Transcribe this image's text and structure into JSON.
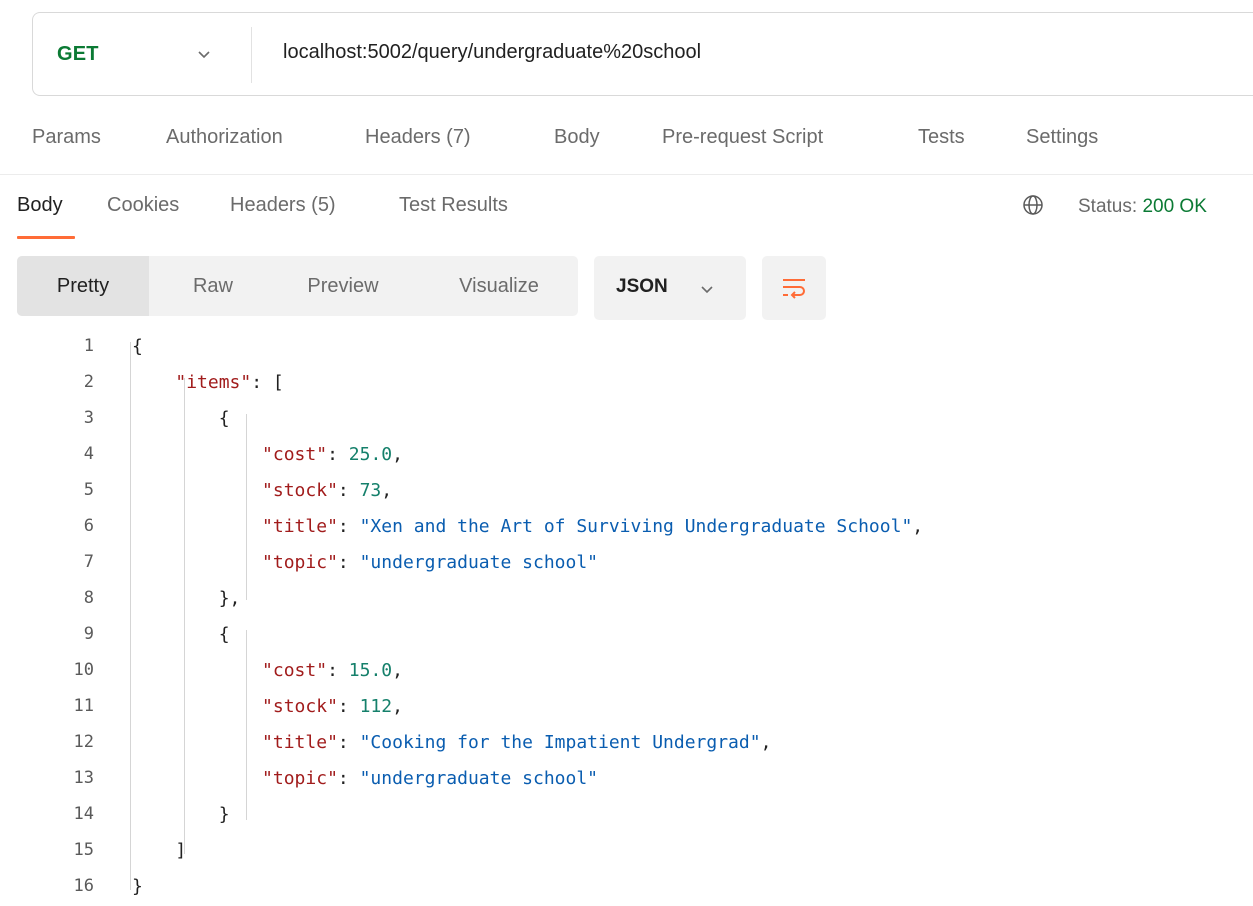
{
  "request": {
    "method": "GET",
    "url": "localhost:5002/query/undergraduate%20school"
  },
  "request_tabs": [
    {
      "label": "Params"
    },
    {
      "label": "Authorization"
    },
    {
      "label": "Headers (7)"
    },
    {
      "label": "Body"
    },
    {
      "label": "Pre-request Script"
    },
    {
      "label": "Tests"
    },
    {
      "label": "Settings"
    }
  ],
  "response_tabs": [
    {
      "label": "Body",
      "active": true
    },
    {
      "label": "Cookies"
    },
    {
      "label": "Headers (5)"
    },
    {
      "label": "Test Results"
    }
  ],
  "status": {
    "label": "Status:",
    "value": "200 OK"
  },
  "view_modes": [
    {
      "label": "Pretty",
      "active": true
    },
    {
      "label": "Raw"
    },
    {
      "label": "Preview"
    },
    {
      "label": "Visualize"
    }
  ],
  "format": "JSON",
  "icons": {
    "method_dropdown": "chevron-down-icon",
    "network": "globe-icon",
    "format_dropdown": "chevron-down-icon",
    "wrap": "wrap-lines-icon"
  },
  "colors": {
    "method": "#0b7a34",
    "status_ok": "#0b7a34",
    "accent": "#ff6c37",
    "json_key": "#a11c1c",
    "json_string": "#0a5db0",
    "json_number": "#15806b"
  },
  "code_lines": [
    [
      {
        "t": "{",
        "c": "punc"
      }
    ],
    [
      {
        "t": "    ",
        "c": "punc"
      },
      {
        "t": "\"items\"",
        "c": "key"
      },
      {
        "t": ": [",
        "c": "punc"
      }
    ],
    [
      {
        "t": "        {",
        "c": "punc"
      }
    ],
    [
      {
        "t": "            ",
        "c": "punc"
      },
      {
        "t": "\"cost\"",
        "c": "key"
      },
      {
        "t": ": ",
        "c": "punc"
      },
      {
        "t": "25.0",
        "c": "num"
      },
      {
        "t": ",",
        "c": "punc"
      }
    ],
    [
      {
        "t": "            ",
        "c": "punc"
      },
      {
        "t": "\"stock\"",
        "c": "key"
      },
      {
        "t": ": ",
        "c": "punc"
      },
      {
        "t": "73",
        "c": "num"
      },
      {
        "t": ",",
        "c": "punc"
      }
    ],
    [
      {
        "t": "            ",
        "c": "punc"
      },
      {
        "t": "\"title\"",
        "c": "key"
      },
      {
        "t": ": ",
        "c": "punc"
      },
      {
        "t": "\"Xen and the Art of Surviving Undergraduate School\"",
        "c": "str"
      },
      {
        "t": ",",
        "c": "punc"
      }
    ],
    [
      {
        "t": "            ",
        "c": "punc"
      },
      {
        "t": "\"topic\"",
        "c": "key"
      },
      {
        "t": ": ",
        "c": "punc"
      },
      {
        "t": "\"undergraduate school\"",
        "c": "str"
      }
    ],
    [
      {
        "t": "        },",
        "c": "punc"
      }
    ],
    [
      {
        "t": "        {",
        "c": "punc"
      }
    ],
    [
      {
        "t": "            ",
        "c": "punc"
      },
      {
        "t": "\"cost\"",
        "c": "key"
      },
      {
        "t": ": ",
        "c": "punc"
      },
      {
        "t": "15.0",
        "c": "num"
      },
      {
        "t": ",",
        "c": "punc"
      }
    ],
    [
      {
        "t": "            ",
        "c": "punc"
      },
      {
        "t": "\"stock\"",
        "c": "key"
      },
      {
        "t": ": ",
        "c": "punc"
      },
      {
        "t": "112",
        "c": "num"
      },
      {
        "t": ",",
        "c": "punc"
      }
    ],
    [
      {
        "t": "            ",
        "c": "punc"
      },
      {
        "t": "\"title\"",
        "c": "key"
      },
      {
        "t": ": ",
        "c": "punc"
      },
      {
        "t": "\"Cooking for the Impatient Undergrad\"",
        "c": "str"
      },
      {
        "t": ",",
        "c": "punc"
      }
    ],
    [
      {
        "t": "            ",
        "c": "punc"
      },
      {
        "t": "\"topic\"",
        "c": "key"
      },
      {
        "t": ": ",
        "c": "punc"
      },
      {
        "t": "\"undergraduate school\"",
        "c": "str"
      }
    ],
    [
      {
        "t": "        }",
        "c": "punc"
      }
    ],
    [
      {
        "t": "    ]",
        "c": "punc"
      }
    ],
    [
      {
        "t": "}",
        "c": "punc"
      }
    ]
  ]
}
